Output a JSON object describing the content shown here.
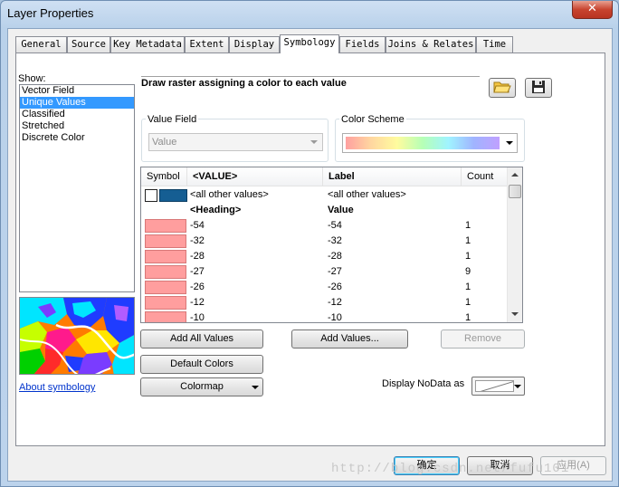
{
  "window": {
    "title": "Layer Properties",
    "close_symbol": "✕"
  },
  "tabs": [
    {
      "label": "General"
    },
    {
      "label": "Source"
    },
    {
      "label": "Key Metadata"
    },
    {
      "label": "Extent"
    },
    {
      "label": "Display"
    },
    {
      "label": "Symbology",
      "active": true
    },
    {
      "label": "Fields"
    },
    {
      "label": "Joins & Relates"
    },
    {
      "label": "Time"
    }
  ],
  "show_panel": {
    "label": "Show:",
    "items": [
      "Vector Field",
      "Unique Values",
      "Classified",
      "Stretched",
      "Discrete Color"
    ],
    "selected": "Unique Values",
    "about_link": "About symbology"
  },
  "main": {
    "heading": "Draw raster assigning a color to each value",
    "value_field": {
      "label": "Value Field",
      "value": "Value"
    },
    "color_scheme": {
      "label": "Color Scheme"
    }
  },
  "table": {
    "headers": [
      "Symbol",
      "<VALUE>",
      "Label",
      "Count"
    ],
    "rows": [
      {
        "value": "<all other values>",
        "label": "<all other values>",
        "count": "",
        "kind": "other"
      },
      {
        "value": "<Heading>",
        "label": "Value",
        "count": "",
        "kind": "heading"
      },
      {
        "value": "-54",
        "label": "-54",
        "count": "1"
      },
      {
        "value": "-32",
        "label": "-32",
        "count": "1"
      },
      {
        "value": "-28",
        "label": "-28",
        "count": "1"
      },
      {
        "value": "-27",
        "label": "-27",
        "count": "9"
      },
      {
        "value": "-26",
        "label": "-26",
        "count": "1"
      },
      {
        "value": "-12",
        "label": "-12",
        "count": "1"
      },
      {
        "value": "-10",
        "label": "-10",
        "count": "1"
      }
    ]
  },
  "buttons": {
    "add_all_values": "Add All Values",
    "add_values": "Add Values...",
    "remove": "Remove",
    "default_colors": "Default Colors",
    "colormap": "Colormap",
    "display_nodata_label": "Display NoData as"
  },
  "footer": {
    "ok": "确定",
    "cancel": "取消",
    "apply": "应用(A)"
  },
  "watermark": "http://blog.csdn.net/fufu101"
}
